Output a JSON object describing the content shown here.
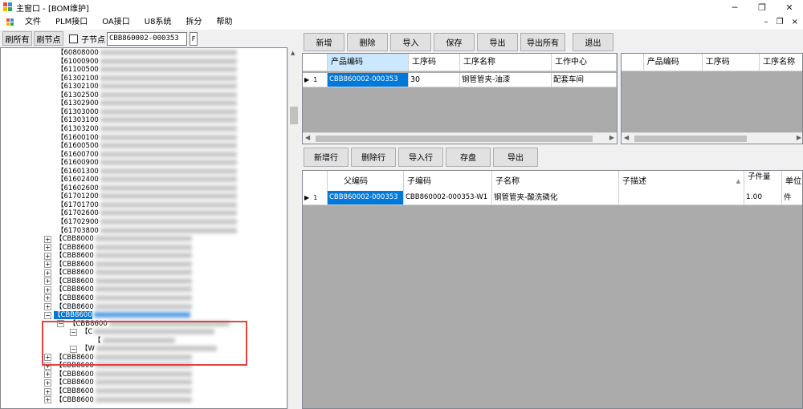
{
  "window": {
    "title": "主窗口 - [BOM维护]",
    "minimize": "─",
    "restore": "❐",
    "close": "✕"
  },
  "menu": {
    "items": [
      "文件",
      "PLM接口",
      "OA接口",
      "U8系统",
      "拆分",
      "帮助"
    ],
    "mdi_min": "–",
    "mdi_restore": "❐",
    "mdi_close": "×"
  },
  "left_toolbar": {
    "refresh_all": "刷所有",
    "refresh_node": "刷节点",
    "child_node_label": "子节点",
    "search_value": "CBB860002-000353",
    "f_button": "F"
  },
  "tree": {
    "items": [
      {
        "text": "【60808000",
        "indent": "deep"
      },
      {
        "text": "【61000900",
        "indent": "deep"
      },
      {
        "text": "【61100500",
        "indent": "deep"
      },
      {
        "text": "【61302100",
        "indent": "deep"
      },
      {
        "text": "【61302100",
        "indent": "deep"
      },
      {
        "text": "【61302500",
        "indent": "deep"
      },
      {
        "text": "【61302900",
        "indent": "deep"
      },
      {
        "text": "【61303000",
        "indent": "deep"
      },
      {
        "text": "【61303100",
        "indent": "deep"
      },
      {
        "text": "【61303200",
        "indent": "deep"
      },
      {
        "text": "【61600100",
        "indent": "deep"
      },
      {
        "text": "【61600500",
        "indent": "deep"
      },
      {
        "text": "【61600700",
        "indent": "deep"
      },
      {
        "text": "【61600900",
        "indent": "deep"
      },
      {
        "text": "【61601300",
        "indent": "deep"
      },
      {
        "text": "【61602400",
        "indent": "deep"
      },
      {
        "text": "【61602600",
        "indent": "deep"
      },
      {
        "text": "【61701200",
        "indent": "deep"
      },
      {
        "text": "【61701700",
        "indent": "deep"
      },
      {
        "text": "【61702600",
        "indent": "deep"
      },
      {
        "text": "【61702900",
        "indent": "deep"
      },
      {
        "text": "【61703800",
        "indent": "deep"
      },
      {
        "text": "【CBB8000",
        "indent": "root"
      },
      {
        "text": "【CBB8600",
        "indent": "root"
      },
      {
        "text": "【CBB8600",
        "indent": "root"
      },
      {
        "text": "【CBB8600",
        "indent": "root"
      },
      {
        "text": "【CBB8600",
        "indent": "root"
      },
      {
        "text": "【CBB8600",
        "indent": "root"
      },
      {
        "text": "【CBB8600",
        "indent": "root"
      },
      {
        "text": "【CBB8600",
        "indent": "root"
      },
      {
        "text": "【CBB8600",
        "indent": "root"
      },
      {
        "text": "【CBB8600",
        "indent": "selected"
      },
      {
        "text": "【CBB8600",
        "indent": "child"
      },
      {
        "text": "【C",
        "indent": "grandchild"
      },
      {
        "text": "【",
        "indent": "greatgrandchild"
      },
      {
        "text": "【W",
        "indent": "grandchild"
      },
      {
        "text": "【CBB8600",
        "indent": "root"
      },
      {
        "text": "【CBB8600",
        "indent": "root"
      },
      {
        "text": "【CBB8600",
        "indent": "root"
      },
      {
        "text": "【CBB8600",
        "indent": "root"
      },
      {
        "text": "【CBB8600",
        "indent": "root"
      },
      {
        "text": "【CBB8600",
        "indent": "root"
      }
    ]
  },
  "top_toolbar": {
    "buttons": [
      "新增",
      "删除",
      "导入",
      "保存",
      "导出",
      "导出所有",
      "退出"
    ]
  },
  "process_grid": {
    "columns": [
      "产品编码",
      "工序码",
      "工序名称",
      "工作中心"
    ],
    "rows": [
      {
        "index": "1",
        "product_code": "CBB860002-000353",
        "process_code": "30",
        "process_name": "钢管管夹-油漆",
        "work_center": "配套车间"
      }
    ]
  },
  "right_grid": {
    "columns": [
      "产品编码",
      "工序码",
      "工序名称"
    ]
  },
  "bottom_toolbar": {
    "buttons": [
      "新增行",
      "删除行",
      "导入行",
      "存盘",
      "导出"
    ]
  },
  "bom_grid": {
    "columns": [
      "父编码",
      "子编码",
      "子名称",
      "子描述",
      "子件量",
      "单位"
    ],
    "rows": [
      {
        "index": "1",
        "parent_code": "CBB860002-000353",
        "child_code": "CBB860002-000353-W1",
        "child_name": "钢管管夹-酸洗磷化",
        "child_desc": "",
        "qty": "1.00",
        "unit": "件"
      }
    ]
  },
  "colors": {
    "selection": "#0078d7",
    "highlight_box": "#e0443a",
    "grid_bg": "#ababab"
  }
}
